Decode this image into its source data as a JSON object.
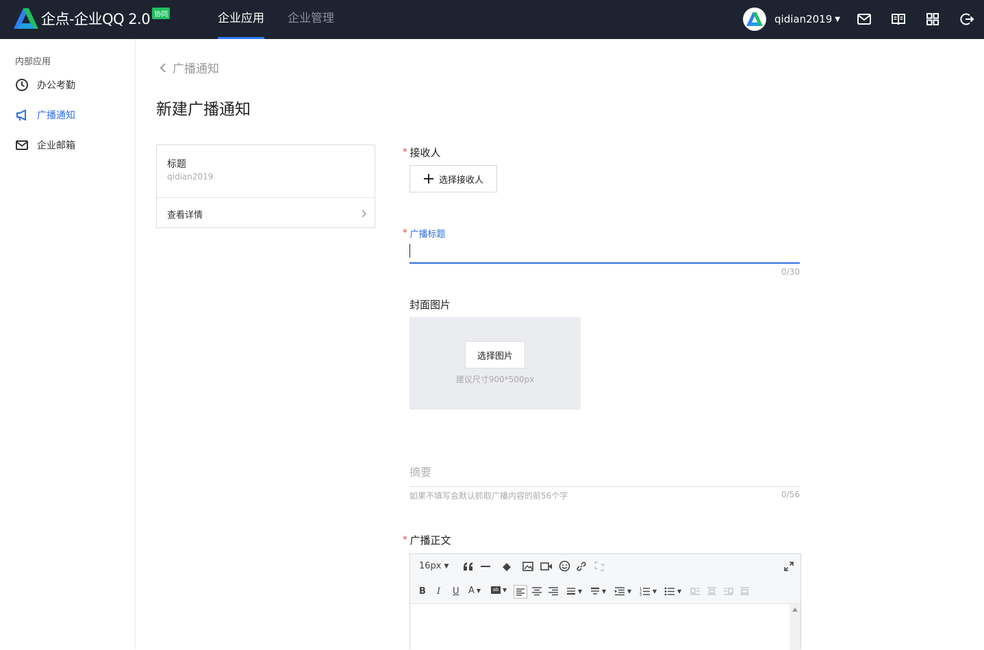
{
  "app": {
    "title": "企点-企业QQ 2.0",
    "badge": "协同"
  },
  "top_nav": {
    "tabs": [
      {
        "label": "企业应用",
        "active": true
      },
      {
        "label": "企业管理",
        "active": false
      }
    ]
  },
  "user": {
    "name": "qidian2019"
  },
  "top_icons": [
    "mail-icon",
    "book-icon",
    "apps-grid-icon",
    "logout-icon"
  ],
  "sidebar": {
    "group_label": "内部应用",
    "items": [
      {
        "label": "办公考勤",
        "icon": "clock-icon",
        "active": false
      },
      {
        "label": "广播通知",
        "icon": "megaphone-icon",
        "active": true
      },
      {
        "label": "企业邮箱",
        "icon": "mail-icon",
        "active": false
      }
    ]
  },
  "breadcrumb": {
    "back_label": "广播通知"
  },
  "page": {
    "title": "新建广播通知"
  },
  "preview": {
    "title": "标题",
    "subtitle": "qidian2019",
    "link": "查看详情"
  },
  "form": {
    "recipients": {
      "label": "接收人",
      "button": "选择接收人"
    },
    "broadcast_title": {
      "label": "广播标题",
      "value": "",
      "counter": "0/30"
    },
    "cover": {
      "label": "封面图片",
      "button": "选择图片",
      "hint": "建议尺寸900*500px"
    },
    "summary": {
      "placeholder": "摘要",
      "hint": "如果不填写会默认抓取广播内容的前56个字",
      "counter": "0/56"
    },
    "body": {
      "label": "广播正文",
      "font_size": "16px"
    }
  },
  "colors": {
    "topbar": "#1d2330",
    "accent": "#2f6ee0",
    "badge": "#1fbf5f",
    "required": "#e53b3b"
  }
}
